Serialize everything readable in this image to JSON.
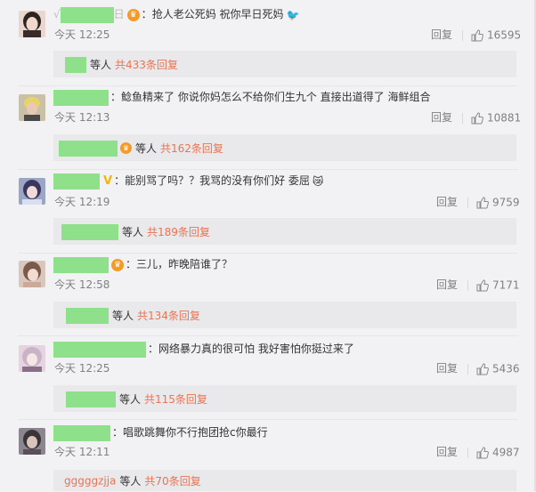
{
  "comments": [
    {
      "name_prefix": "√",
      "name_suffix": "日",
      "colon": "：",
      "text": "抢人老公死妈 祝你早日死妈",
      "emoji": "🐦",
      "time": "今天 12:25",
      "reply": "回复",
      "likes": "16595",
      "sub_etc": "等人",
      "sub_count": "共433条回复"
    },
    {
      "colon": "：",
      "text": "鲶鱼精来了 你说你妈怎么不给你们生九个 直接出道得了 海鲜组合",
      "time": "今天 12:13",
      "reply": "回复",
      "likes": "10881",
      "sub_etc": "等人",
      "sub_count": "共162条回复"
    },
    {
      "vbadge": "V",
      "colon": "：",
      "text": "能别骂了吗？？我骂的没有你们好 委屈",
      "emoji": "😿",
      "time": "今天 12:19",
      "reply": "回复",
      "likes": "9759",
      "sub_etc": "等人",
      "sub_count": "共189条回复"
    },
    {
      "colon": "：",
      "text": "三儿，昨晚陪谁了？",
      "time": "今天 12:58",
      "reply": "回复",
      "likes": "7171",
      "sub_etc": "等人",
      "sub_count": "共134条回复"
    },
    {
      "colon": "：",
      "text": "网络暴力真的很可怕 我好害怕你挺过来了",
      "time": "今天 12:25",
      "reply": "回复",
      "likes": "5436",
      "sub_etc": "等人",
      "sub_count": "共115条回复"
    },
    {
      "colon": "：",
      "text": "唱歌跳舞你不行抱团抢c你最行",
      "time": "今天 12:11",
      "reply": "回复",
      "likes": "4987",
      "sub_user": "gggggzjja",
      "sub_etc": "等人",
      "sub_count": "共70条回复"
    }
  ],
  "colors": {
    "background": "#f2f2f5",
    "sub_box": "#e9e9ec",
    "link_orange": "#eb7350",
    "masked_name_green": "#8ee08a"
  },
  "icons": {
    "like": "thumbs-up-icon",
    "badge": "vip-badge-icon"
  }
}
